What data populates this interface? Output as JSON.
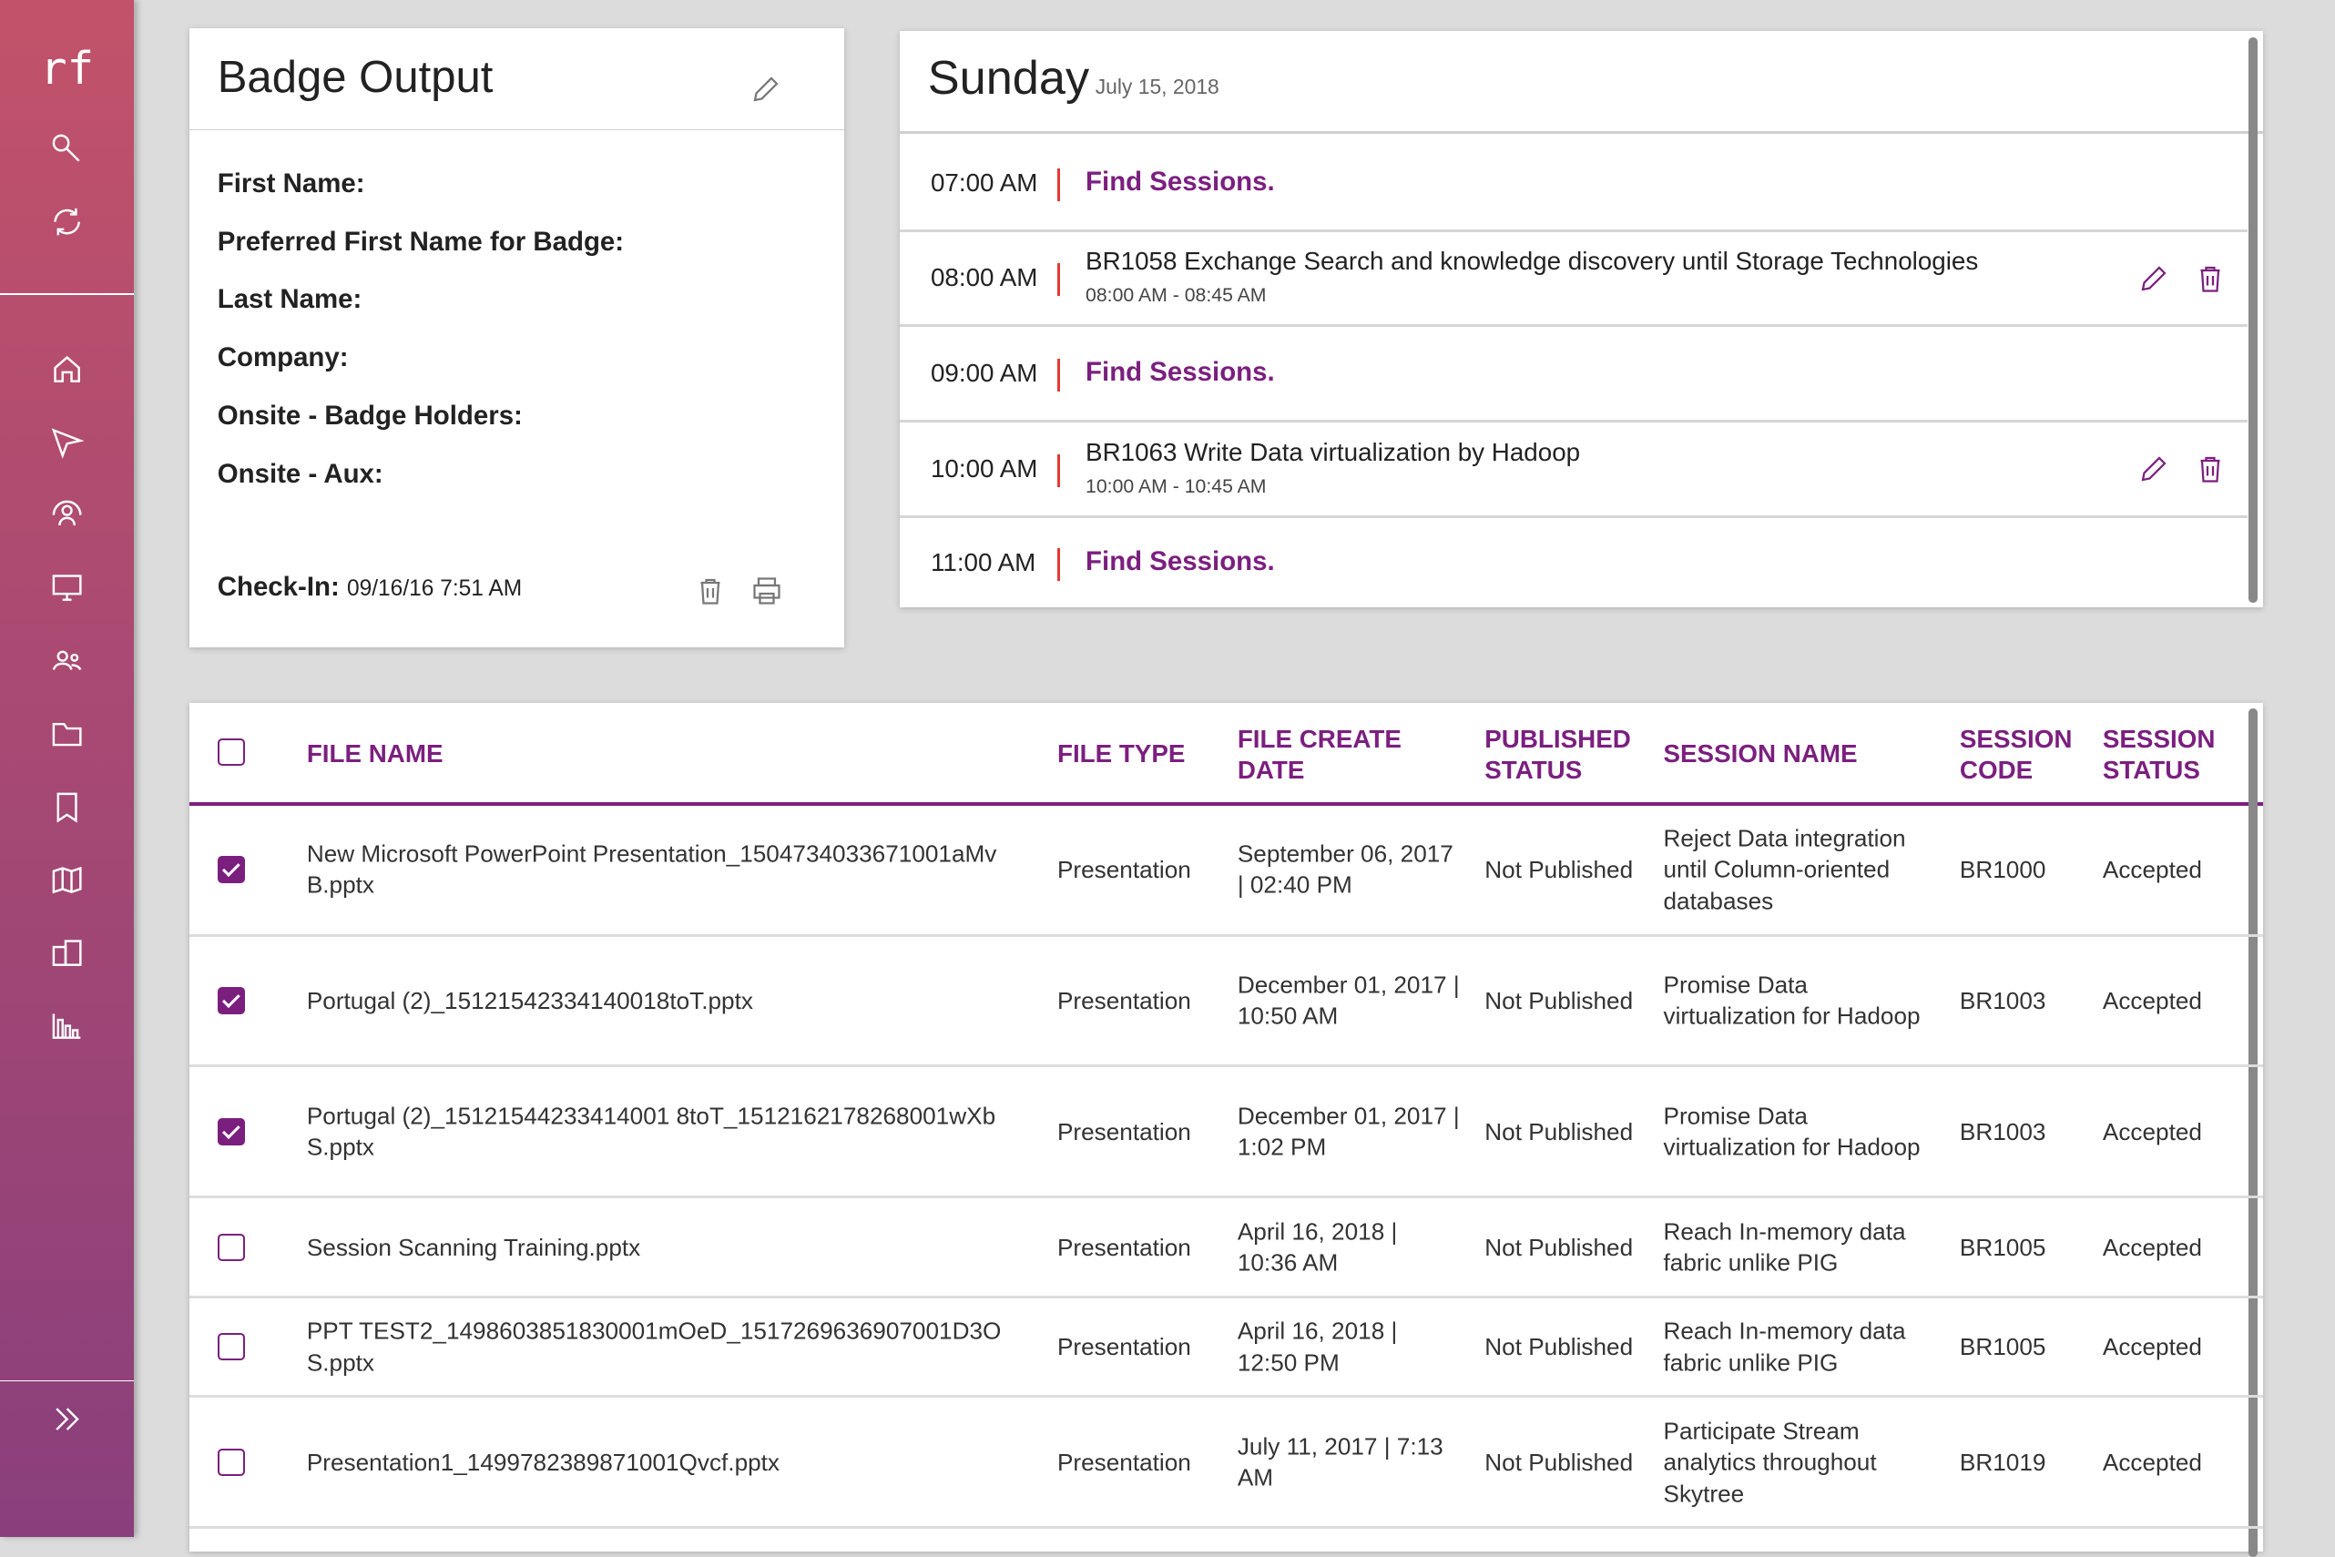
{
  "sidebar": {
    "logo": "rf",
    "icons": [
      "search-icon",
      "refresh-icon",
      "home-icon",
      "send-icon",
      "user-sync-icon",
      "monitor-icon",
      "users-icon",
      "folder-icon",
      "bookmark-icon",
      "map-icon",
      "building-icon",
      "bar-chart-icon"
    ],
    "expand_icon": "double-chevron-right-icon"
  },
  "badge": {
    "title": "Badge Output",
    "fields": [
      "First Name:",
      "Preferred First Name for Badge:",
      "Last Name:",
      "Company:",
      "Onsite - Badge Holders:",
      "Onsite - Aux:"
    ],
    "checkin_label": "Check-In:",
    "checkin_value": "09/16/16 7:51 AM"
  },
  "schedule": {
    "day": "Sunday",
    "date": "July 15, 2018",
    "slots": [
      {
        "time": "07:00 AM",
        "find": "Find Sessions."
      },
      {
        "time": "08:00 AM",
        "title": "BR1058 Exchange Search and knowledge discovery until Storage Technologies",
        "range": "08:00 AM - 08:45 AM"
      },
      {
        "time": "09:00 AM",
        "find": "Find Sessions."
      },
      {
        "time": "10:00 AM",
        "title": "BR1063 Write Data virtualization by Hadoop",
        "range": "10:00 AM - 10:45 AM"
      },
      {
        "time": "11:00 AM",
        "find": "Find Sessions."
      }
    ]
  },
  "table": {
    "headers": [
      "FILE NAME",
      "FILE TYPE",
      "FILE CREATE DATE",
      "PUBLISHED STATUS",
      "SESSION NAME",
      "SESSION CODE",
      "SESSION STATUS"
    ],
    "rows": [
      {
        "checked": true,
        "name": "New Microsoft PowerPoint Presentation_1504734033671001aMvB.pptx",
        "type": "Presentation",
        "date": "September 06, 2017 | 02:40 PM",
        "published": "Not Published",
        "session": "Reject Data integration until Column-oriented databases",
        "code": "BR1000",
        "status": "Accepted"
      },
      {
        "checked": true,
        "name": "Portugal (2)_15121542334140018toT.pptx",
        "type": "Presentation",
        "date": "December 01, 2017 | 10:50 AM",
        "published": "Not Published",
        "session": "Promise Data virtualization for Hadoop",
        "code": "BR1003",
        "status": "Accepted"
      },
      {
        "checked": true,
        "name": "Portugal (2)_15121544233414001 8toT_1512162178268001wXbS.pptx",
        "type": "Presentation",
        "date": "December 01, 2017 | 1:02 PM",
        "published": "Not Published",
        "session": "Promise Data virtualization for Hadoop",
        "code": "BR1003",
        "status": "Accepted"
      },
      {
        "checked": false,
        "name": "Session Scanning Training.pptx",
        "type": "Presentation",
        "date": "April 16, 2018 | 10:36 AM",
        "published": "Not Published",
        "session": "Reach In-memory data fabric unlike PIG",
        "code": "BR1005",
        "status": "Accepted"
      },
      {
        "checked": false,
        "name": "PPT TEST2_1498603851830001mOeD_1517269636907001D3OS.pptx",
        "type": "Presentation",
        "date": "April 16, 2018 | 12:50 PM",
        "published": "Not Published",
        "session": "Reach In-memory data fabric unlike PIG",
        "code": "BR1005",
        "status": "Accepted"
      },
      {
        "checked": false,
        "name": "Presentation1_1499782389871001Qvcf.pptx",
        "type": "Presentation",
        "date": "July 11, 2017 | 7:13 AM",
        "published": "Not Published",
        "session": "Participate Stream analytics throughout Skytree",
        "code": "BR1019",
        "status": "Accepted"
      }
    ]
  },
  "colors": {
    "accent": "#7b1f7f",
    "divider": "#e53935",
    "sidebar_top": "#c2526a",
    "sidebar_bottom": "#8a3f7c"
  }
}
